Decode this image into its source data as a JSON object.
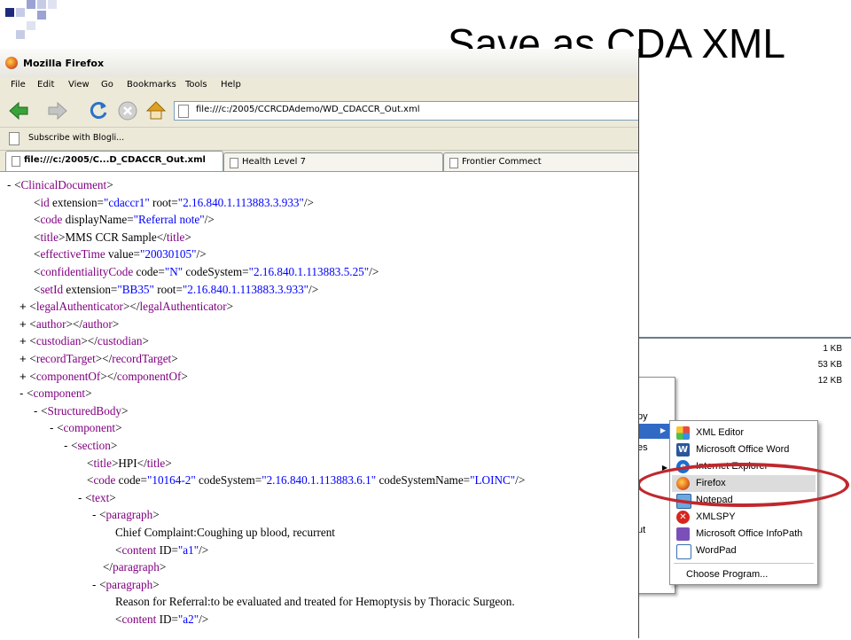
{
  "slide_title": "Save as CDA XML",
  "firefox": {
    "window_title": "Mozilla Firefox",
    "menus": [
      "File",
      "Edit",
      "View",
      "Go",
      "Bookmarks",
      "Tools",
      "Help"
    ],
    "url": "file:///c:/2005/CCRCDAdemo/WD_CDACCR_Out.xml",
    "bookmark": "Subscribe with Blogli...",
    "tabs": [
      "file:///c:/2005/C...D_CDACCR_Out.xml",
      "Health Level 7",
      "Frontier Commect"
    ]
  },
  "xml_lines": [
    [
      "-",
      "ClinicalDocument",
      [],
      ">"
    ],
    [
      "",
      "id",
      [
        [
          "extension",
          "cdaccr1"
        ],
        [
          "root",
          "2.16.840.1.113883.3.933"
        ]
      ],
      "/>"
    ],
    [
      "",
      "code",
      [
        [
          "displayName",
          "Referral note"
        ]
      ],
      "/>"
    ],
    [
      "",
      "title",
      [],
      ">",
      "MMS CCR Sample",
      "title"
    ],
    [
      "",
      "effectiveTime",
      [
        [
          "value",
          "20030105"
        ]
      ],
      "/>"
    ],
    [
      "",
      "confidentialityCode",
      [
        [
          "code",
          "N"
        ],
        [
          "codeSystem",
          "2.16.840.1.113883.5.25"
        ]
      ],
      "/>"
    ],
    [
      "",
      "setId",
      [
        [
          "extension",
          "BB35"
        ],
        [
          "root",
          "2.16.840.1.113883.3.933"
        ]
      ],
      "/>"
    ],
    [
      "+",
      "legalAuthenticator",
      [],
      ">",
      "",
      "legalAuthenticator"
    ],
    [
      "+",
      "author",
      [],
      ">",
      "",
      "author"
    ],
    [
      "+",
      "custodian",
      [],
      ">",
      "",
      "custodian"
    ],
    [
      "+",
      "recordTarget",
      [],
      ">",
      "",
      "recordTarget"
    ],
    [
      "+",
      "componentOf",
      [],
      ">",
      "",
      "componentOf"
    ],
    [
      "-",
      "component",
      [],
      ">"
    ],
    [
      "-",
      "StructuredBody",
      [],
      ">"
    ],
    [
      "-",
      "component",
      [],
      ">"
    ],
    [
      "-",
      "section",
      [],
      ">"
    ],
    [
      "",
      "title",
      [],
      ">",
      "HPI",
      "title"
    ],
    [
      "",
      "code",
      [
        [
          "code",
          "10164-2"
        ],
        [
          "codeSystem",
          "2.16.840.1.113883.6.1"
        ],
        [
          "codeSystemName",
          "LOINC"
        ]
      ],
      "/>"
    ],
    [
      "-",
      "text",
      [],
      ">"
    ],
    [
      "-",
      "paragraph",
      [],
      ">"
    ],
    [
      "text",
      "Chief Complaint:Coughing up blood, recurrent"
    ],
    [
      "",
      "content",
      [
        [
          "ID",
          "a1"
        ]
      ],
      "/>"
    ],
    [
      "close",
      "paragraph"
    ],
    [
      "-",
      "paragraph",
      [],
      ">"
    ],
    [
      "text",
      "Reason for Referral:to be evaluated and treated for Hemoptysis by Thoracic Surgeon."
    ],
    [
      "",
      "content",
      [
        [
          "ID",
          "a2"
        ]
      ],
      "/>"
    ]
  ],
  "explorer_sizes": [
    "1 KB",
    "53 KB",
    "12 KB"
  ],
  "context_menu": [
    "py",
    "es",
    "ut"
  ],
  "open_with": {
    "items": [
      "XML Editor",
      "Microsoft Office Word",
      "Internet Explorer",
      "Firefox",
      "Notepad",
      "XMLSPY",
      "Microsoft Office InfoPath",
      "WordPad"
    ],
    "choose": "Choose Program...",
    "selected": "Firefox"
  },
  "colors": {
    "tag": "#800080",
    "attr_value": "#0000ff",
    "highlight_ellipse": "#c0282d"
  }
}
